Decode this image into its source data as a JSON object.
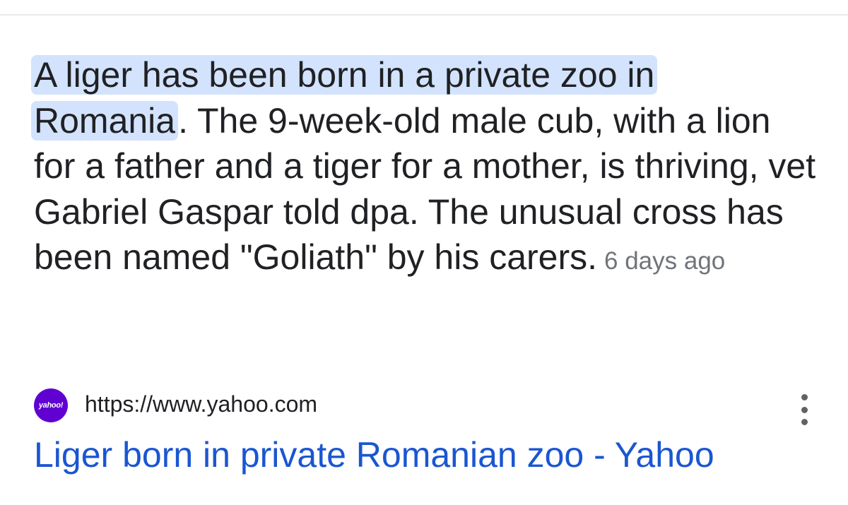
{
  "snippet": {
    "highlighted_text": "A liger has been born in a private zoo in Romania",
    "body_text": ". The 9-week-old male cub, with a lion for a father and a tiger for a mother, is thriving, vet Gabriel Gaspar told dpa. The unusual cross has been named \"Goliath\" by his carers.",
    "date": "6 days ago"
  },
  "source": {
    "favicon_label": "yahoo!",
    "url": "https://www.yahoo.com",
    "more_icon": "more-vert-icon"
  },
  "result": {
    "title": "Liger born in private Romanian zoo - Yahoo"
  },
  "colors": {
    "highlight": "#d3e3fd",
    "link": "#1a56d1",
    "favicon_bg": "#6001d2",
    "date_text": "#70757a"
  }
}
